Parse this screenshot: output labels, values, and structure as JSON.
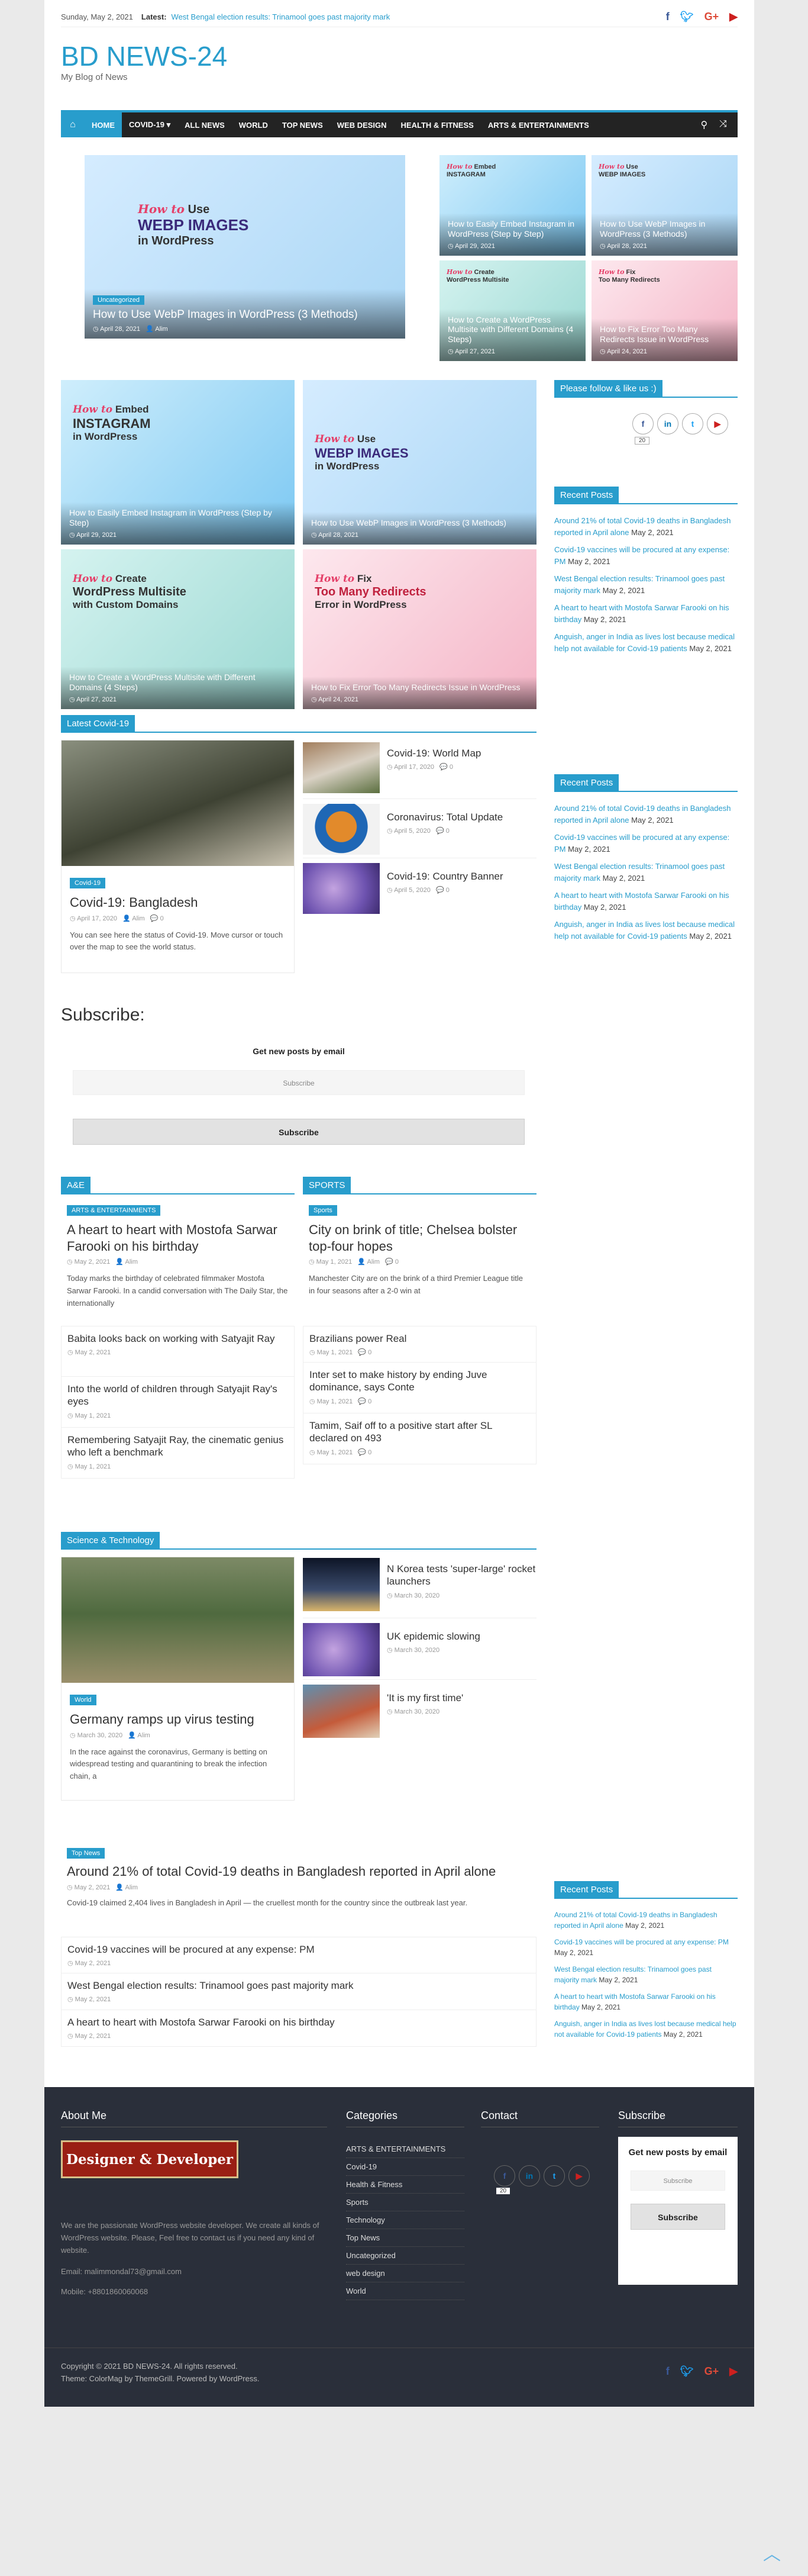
{
  "topbar": {
    "date": "Sunday, May 2, 2021",
    "latest_label": "Latest:",
    "ticker": "West Bengal election results: Trinamool goes past majority mark"
  },
  "site": {
    "title": "BD NEWS-24",
    "description": "My Blog of News"
  },
  "nav": {
    "items": [
      "HOME",
      "COVID-19 ▾",
      "ALL NEWS",
      "WORLD",
      "TOP NEWS",
      "WEB DESIGN",
      "HEALTH & FITNESS",
      "ARTS & ENTERTAINMENTS"
    ]
  },
  "featured": {
    "main": {
      "cat": "Uncategorized",
      "title": "How to Use WebP Images in WordPress (3 Methods)",
      "date": "April 28, 2021",
      "author": "Alim",
      "art": [
        "How to",
        "Use",
        "WEBP IMAGES",
        "in WordPress"
      ]
    },
    "small": [
      {
        "title": "How to Easily Embed Instagram in WordPress (Step by Step)",
        "date": "April 29, 2021",
        "art": [
          "How to",
          "Embed",
          "INSTAGRAM",
          "in WordPress"
        ]
      },
      {
        "title": "How to Use WebP Images in WordPress (3 Methods)",
        "date": "April 28, 2021",
        "art": [
          "How to",
          "Use",
          "WEBP IMAGES",
          "in WordPress"
        ]
      },
      {
        "title": "How to Create a WordPress Multisite with Different Domains (4 Steps)",
        "date": "April 27, 2021",
        "art": [
          "How to",
          "Create",
          "WordPress Multisite",
          "with Custom Domains"
        ]
      },
      {
        "title": "How to Fix Error Too Many Redirects Issue in WordPress",
        "date": "April 24, 2021",
        "art": [
          "How to",
          "Fix",
          "Too Many Redirects",
          "Error in WordPress"
        ]
      }
    ]
  },
  "grid": [
    {
      "title": "How to Easily Embed Instagram in WordPress (Step by Step)",
      "date": "April 29, 2021",
      "art": [
        "How to",
        "Embed",
        "INSTAGRAM",
        "in WordPress"
      ]
    },
    {
      "title": "How to Use WebP Images in WordPress (3 Methods)",
      "date": "April 28, 2021",
      "art": [
        "How to",
        "Use",
        "WEBP IMAGES",
        "in WordPress"
      ]
    },
    {
      "title": "How to Create a WordPress Multisite with Different Domains (4 Steps)",
      "date": "April 27, 2021",
      "art": [
        "How to",
        "Create",
        "WordPress Multisite",
        "with Custom Domains"
      ]
    },
    {
      "title": "How to Fix Error Too Many Redirects Issue in WordPress",
      "date": "April 24, 2021",
      "art": [
        "How to",
        "Fix",
        "Too Many Redirects",
        "Error in WordPress"
      ]
    }
  ],
  "covid": {
    "heading": "Latest Covid-19",
    "main": {
      "cat": "Covid-19",
      "title": "Covid-19: Bangladesh",
      "date": "April 17, 2020",
      "author": "Alim",
      "comments": "0",
      "excerpt": "You can see here the status of Covid-19. Move cursor or touch over the map to see the world status."
    },
    "list": [
      {
        "title": "Covid-19: World Map",
        "date": "April 17, 2020",
        "comments": "0"
      },
      {
        "title": "Coronavirus: Total Update",
        "date": "April 5, 2020",
        "comments": "0"
      },
      {
        "title": "Covid-19: Country Banner",
        "date": "April 5, 2020",
        "comments": "0"
      }
    ]
  },
  "subscribe": {
    "heading": "Subscribe:",
    "label": "Get new posts by email",
    "placeholder": "Subscribe",
    "button": "Subscribe"
  },
  "ae": {
    "heading": "A&E",
    "main": {
      "cat": "ARTS & ENTERTAINMENTS",
      "title": "A heart to heart with Mostofa Sarwar Farooki on his birthday",
      "date": "May 2, 2021",
      "author": "Alim",
      "excerpt": "Today marks the birthday of celebrated filmmaker Mostofa Sarwar Farooki. In a candid conversation with The Daily Star, the internationally"
    },
    "list": [
      {
        "title": "Babita looks back on working with Satyajit Ray",
        "date": "May 2, 2021"
      },
      {
        "title": "Into the world of children through Satyajit Ray's eyes",
        "date": "May 1, 2021"
      },
      {
        "title": "Remembering Satyajit Ray, the cinematic genius who left a benchmark",
        "date": "May 1, 2021"
      }
    ]
  },
  "sports": {
    "heading": "SPORTS",
    "main": {
      "cat": "Sports",
      "title": "City on brink of title; Chelsea bolster top-four hopes",
      "date": "May 1, 2021",
      "author": "Alim",
      "comments": "0",
      "excerpt": "Manchester City are on the brink of a third Premier League title in four seasons after a 2-0 win at"
    },
    "list": [
      {
        "title": "Brazilians power Real",
        "date": "May 1, 2021",
        "comments": "0"
      },
      {
        "title": "Inter set to make history by ending Juve dominance, says Conte",
        "date": "May 1, 2021",
        "comments": "0"
      },
      {
        "title": "Tamim, Saif off to a positive start after SL declared on 493",
        "date": "May 1, 2021",
        "comments": "0"
      }
    ]
  },
  "scitech": {
    "heading": "Science & Technology",
    "main": {
      "cat": "World",
      "title": "Germany ramps up virus testing",
      "date": "March 30, 2020",
      "author": "Alim",
      "excerpt": "In the race against the coronavirus, Germany is betting on widespread testing and quarantining to break the infection chain, a"
    },
    "list": [
      {
        "title": "N Korea tests 'super-large' rocket launchers",
        "date": "March 30, 2020"
      },
      {
        "title": "UK epidemic slowing",
        "date": "March 30, 2020"
      },
      {
        "title": "'It is my first time'",
        "date": "March 30, 2020"
      }
    ]
  },
  "topnews": {
    "main": {
      "cat": "Top News",
      "title": "Around 21% of total Covid-19 deaths in Bangladesh reported in April alone",
      "date": "May 2, 2021",
      "author": "Alim",
      "excerpt": "Covid-19 claimed 2,404 lives in Bangladesh in April — the cruellest month for the country since the outbreak last year."
    },
    "list": [
      {
        "title": "Covid-19 vaccines will be procured at any expense: PM",
        "date": "May 2, 2021"
      },
      {
        "title": "West Bengal election results: Trinamool goes past majority mark",
        "date": "May 2, 2021"
      },
      {
        "title": "A heart to heart with Mostofa Sarwar Farooki on his birthday",
        "date": "May 2, 2021"
      }
    ]
  },
  "sidebar": {
    "follow_heading": "Please follow & like us :)",
    "follow_count": "20",
    "recent_heading": "Recent Posts",
    "recent": [
      {
        "title": "Anguish, anger in India as lives lost because medical help not available for Covid-19 patients",
        "date": "May 2, 2021"
      },
      {
        "title": "Around 21% of total Covid-19 deaths in Bangladesh reported in April alone",
        "date": "May 2, 2021"
      },
      {
        "title": "Covid-19 vaccines will be procured at any expense: PM",
        "date": "May 2, 2021"
      },
      {
        "title": "West Bengal election results: Trinamool goes past majority mark",
        "date": "May 2, 2021"
      },
      {
        "title": "A heart to heart with Mostofa Sarwar Farooki on his birthday",
        "date": "May 2, 2021"
      }
    ]
  },
  "footer": {
    "about_heading": "About Me",
    "logo_text": "Designer & Developer",
    "about_text": "We are the passionate WordPress website developer. We create all kinds of WordPress website. Please, Feel free to contact us if you need any kind of website.",
    "email": "Email: malimmondal73@gmail.com",
    "mobile": "Mobile: +8801860060068",
    "cat_heading": "Categories",
    "categories": [
      "ARTS & ENTERTAINMENTS",
      "Covid-19",
      "Health & Fitness",
      "Sports",
      "Technology",
      "Top News",
      "Uncategorized",
      "web design",
      "World"
    ],
    "contact_heading": "Contact",
    "contact_count": "20",
    "subscribe_heading": "Subscribe",
    "sub_label": "Get new posts by email",
    "sub_placeholder": "Subscribe",
    "sub_button": "Subscribe",
    "copyright": "Copyright © 2021 BD NEWS-24. All rights reserved.",
    "theme": "Theme: ColorMag by ThemeGrill. Powered by WordPress."
  },
  "colors": {
    "accent": "#289dcc",
    "nav_bg": "#232323",
    "footer_bg": "#2a2f3a"
  }
}
